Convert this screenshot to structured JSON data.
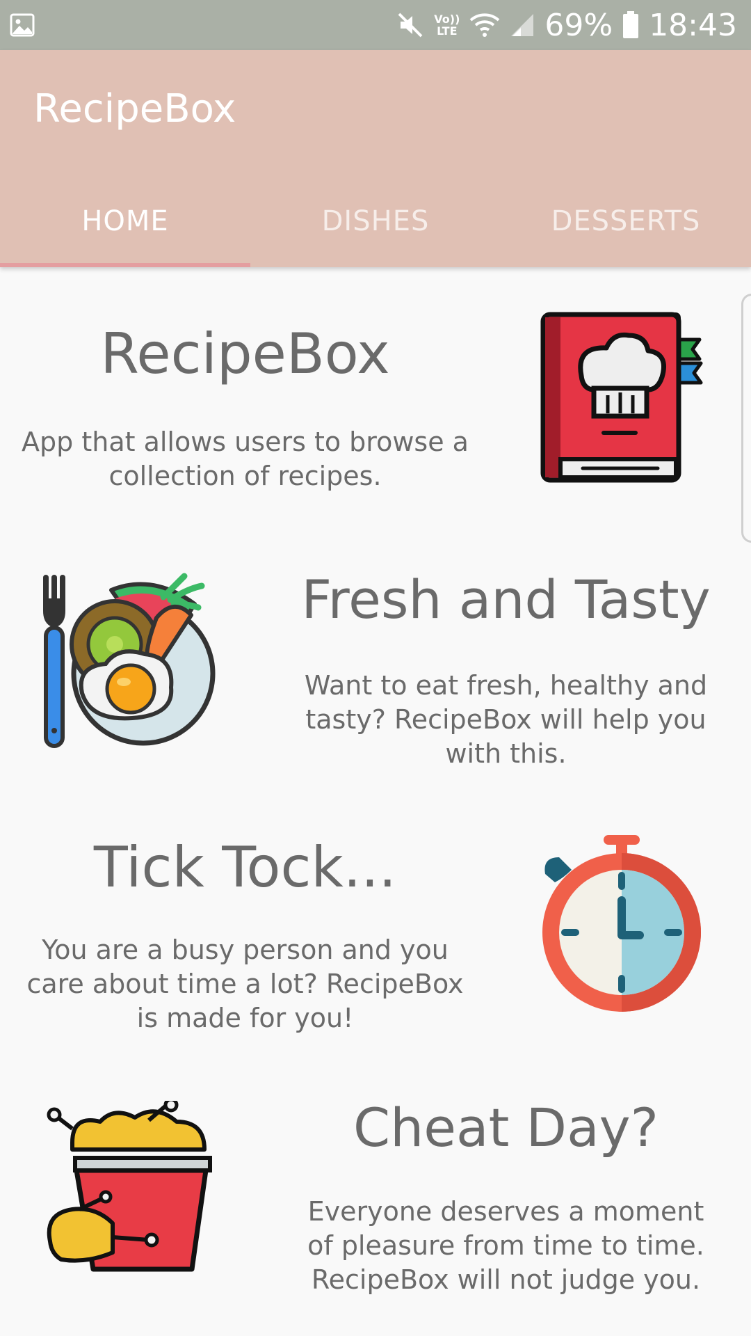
{
  "status_bar": {
    "volte_line1": "Vo))",
    "volte_line2": "LTE",
    "battery": "69%",
    "time": "18:43",
    "icons": [
      "gallery-icon",
      "mute-icon",
      "wifi-icon",
      "signal-icon",
      "battery-icon"
    ]
  },
  "app_bar": {
    "title": "RecipeBox",
    "tabs": [
      {
        "label": "HOME",
        "selected": true
      },
      {
        "label": "DISHES",
        "selected": false
      },
      {
        "label": "DESSERTS",
        "selected": false
      }
    ]
  },
  "sections": [
    {
      "heading": "RecipeBox",
      "text": "App that allows users to browse a collection of recipes.",
      "icon": "recipe-book-icon"
    },
    {
      "heading": "Fresh and Tasty",
      "text": "Want to eat fresh, healthy and tasty? RecipeBox will help you with this.",
      "icon": "fresh-food-plate-icon"
    },
    {
      "heading": "Tick Tock...",
      "text": "You are a busy person and you care about time a lot? RecipeBox is made for you!",
      "icon": "stopwatch-icon"
    },
    {
      "heading": "Cheat Day?",
      "text": "Everyone deserves a moment of pleasure from time to time. RecipeBox will not judge you.",
      "icon": "fried-chicken-bucket-icon"
    }
  ],
  "colors": {
    "status_bar": "#aab0a6",
    "app_bar": "#e0c0b4",
    "tab_indicator": "#e49ea0",
    "background": "#f9f9f9",
    "text": "#6a6a6a"
  }
}
